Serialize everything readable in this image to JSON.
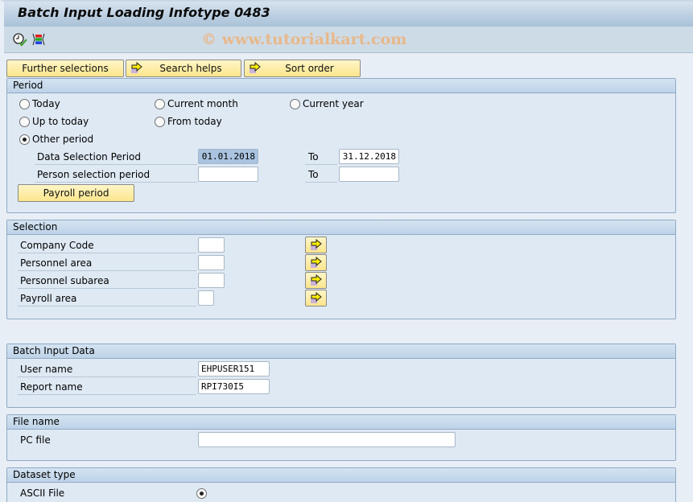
{
  "window": {
    "title": "Batch Input Loading Infotype 0483",
    "watermark": "© www.tutorialkart.com"
  },
  "toolbar": {
    "icons": [
      "execute-clock-icon",
      "selection-options-icon"
    ]
  },
  "buttons": {
    "further_selections": "Further selections",
    "search_helps": "Search helps",
    "sort_order": "Sort order",
    "payroll_period": "Payroll period"
  },
  "period": {
    "header": "Period",
    "radios": [
      {
        "label": "Today",
        "checked": false
      },
      {
        "label": "Current month",
        "checked": false
      },
      {
        "label": "Current year",
        "checked": false
      },
      {
        "label": "Up to today",
        "checked": false
      },
      {
        "label": "From today",
        "checked": false
      },
      {
        "label": "Other period",
        "checked": true
      }
    ],
    "data_selection": {
      "label": "Data Selection Period",
      "from": "01.01.2018",
      "to_label": "To",
      "to": "31.12.2018"
    },
    "person_selection": {
      "label": "Person selection period",
      "from": "",
      "to_label": "To",
      "to": ""
    }
  },
  "selection": {
    "header": "Selection",
    "rows": [
      {
        "label": "Company Code",
        "value": ""
      },
      {
        "label": "Personnel area",
        "value": ""
      },
      {
        "label": "Personnel subarea",
        "value": ""
      },
      {
        "label": "Payroll area",
        "value": ""
      }
    ]
  },
  "batch_input": {
    "header": "Batch Input Data",
    "user_name": {
      "label": "User name",
      "value": "EHPUSER151"
    },
    "report_name": {
      "label": "Report name",
      "value": "RPI730I5"
    }
  },
  "file_name": {
    "header": "File name",
    "pc_file": {
      "label": "PC file",
      "value": ""
    }
  },
  "dataset_type": {
    "header": "Dataset type",
    "ascii_file": {
      "label": "ASCII File",
      "checked": true
    }
  }
}
